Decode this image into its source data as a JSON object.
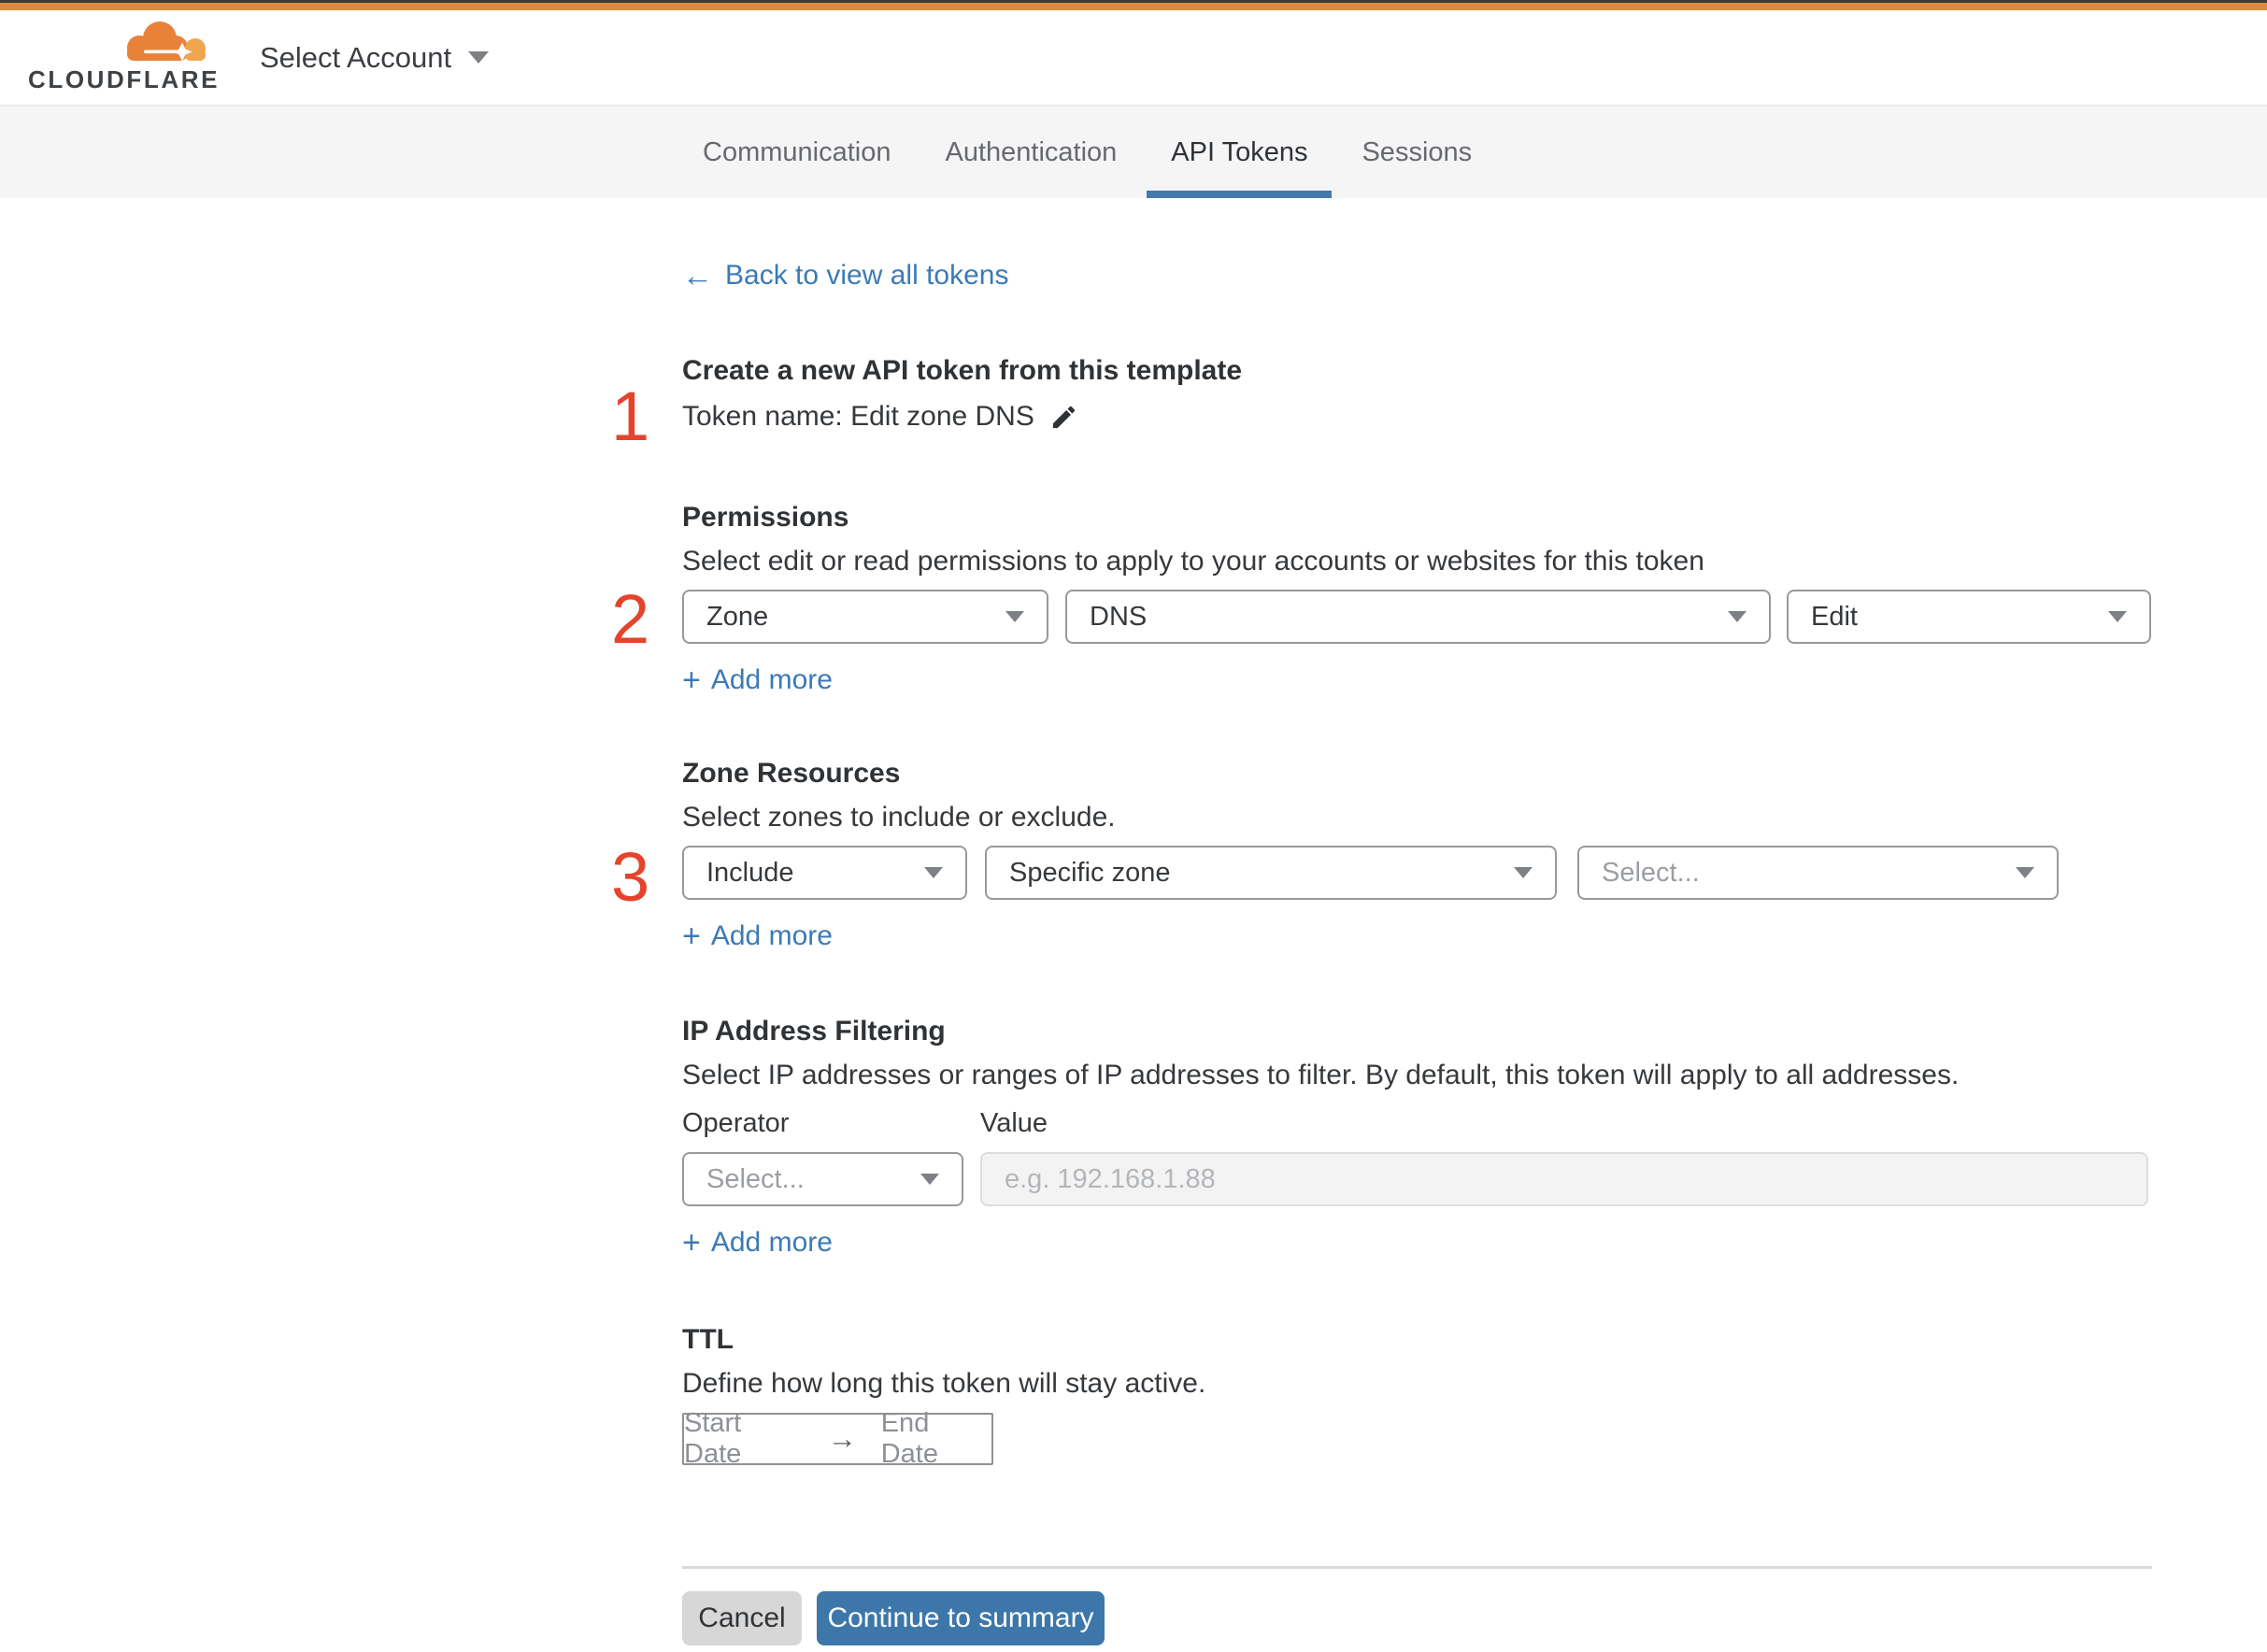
{
  "brand": {
    "logo_text": "CLOUDFLARE",
    "account_selector": "Select Account",
    "accent_orange": "#dd8a3c"
  },
  "tabs": [
    {
      "label": "Communication",
      "active": false
    },
    {
      "label": "Authentication",
      "active": false
    },
    {
      "label": "API Tokens",
      "active": true
    },
    {
      "label": "Sessions",
      "active": false
    }
  ],
  "back_link": {
    "arrow": "←",
    "label": "Back to view all tokens"
  },
  "sections": {
    "create": {
      "step": "1",
      "title": "Create a new API token from this template",
      "token_name": "Token name: Edit zone DNS"
    },
    "permissions": {
      "step": "2",
      "title": "Permissions",
      "description": "Select edit or read permissions to apply to your accounts or websites for this token",
      "selects": [
        "Zone",
        "DNS",
        "Edit"
      ],
      "add_more_plus": "+",
      "add_more": "Add more"
    },
    "zone_resources": {
      "step": "3",
      "title": "Zone Resources",
      "description": "Select zones to include or exclude.",
      "selects": [
        "Include",
        "Specific zone"
      ],
      "select_placeholder": "Select...",
      "add_more_plus": "+",
      "add_more": "Add more"
    },
    "ip_filtering": {
      "title": "IP Address Filtering",
      "description": "Select IP addresses or ranges of IP addresses to filter. By default, this token will apply to all addresses.",
      "operator_label": "Operator",
      "value_label": "Value",
      "operator_placeholder": "Select...",
      "value_placeholder": "e.g. 192.168.1.88",
      "add_more_plus": "+",
      "add_more": "Add more"
    },
    "ttl": {
      "title": "TTL",
      "description": "Define how long this token will stay active.",
      "start_date": "Start Date",
      "arrow": "→",
      "end_date": "End Date"
    }
  },
  "footer": {
    "cancel": "Cancel",
    "continue": "Continue to summary"
  },
  "colors": {
    "step_number_red": "#e5432c",
    "link_blue": "#3b7ab8",
    "tab_underline_blue": "#4379ab",
    "primary_button_blue": "#3d77aa",
    "topbar_orange": "#dd8a3c"
  }
}
